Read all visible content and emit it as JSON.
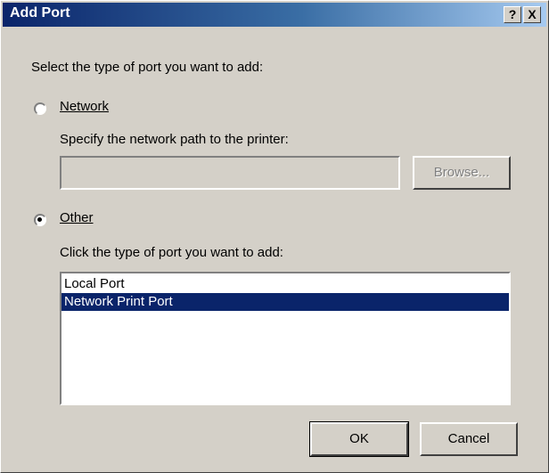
{
  "window": {
    "title": "Add Port",
    "help_button": "?",
    "close_button": "X"
  },
  "prompt": "Select the type of port you want to add:",
  "network": {
    "label": "Network",
    "selected": false,
    "path_label": "Specify the network path to the printer:",
    "path_value": "",
    "browse_label": "Browse...",
    "browse_enabled": false
  },
  "other": {
    "label": "Other",
    "selected": true,
    "list_label": "Click the type of port you want to add:",
    "ports": [
      "Local Port",
      "Network Print Port"
    ],
    "selected_port": "Network Print Port"
  },
  "buttons": {
    "ok": "OK",
    "cancel": "Cancel"
  },
  "colors": {
    "titlebar_start": "#0a246a",
    "titlebar_end": "#a6caf0",
    "selection": "#0a246a",
    "face": "#d4d0c8"
  }
}
